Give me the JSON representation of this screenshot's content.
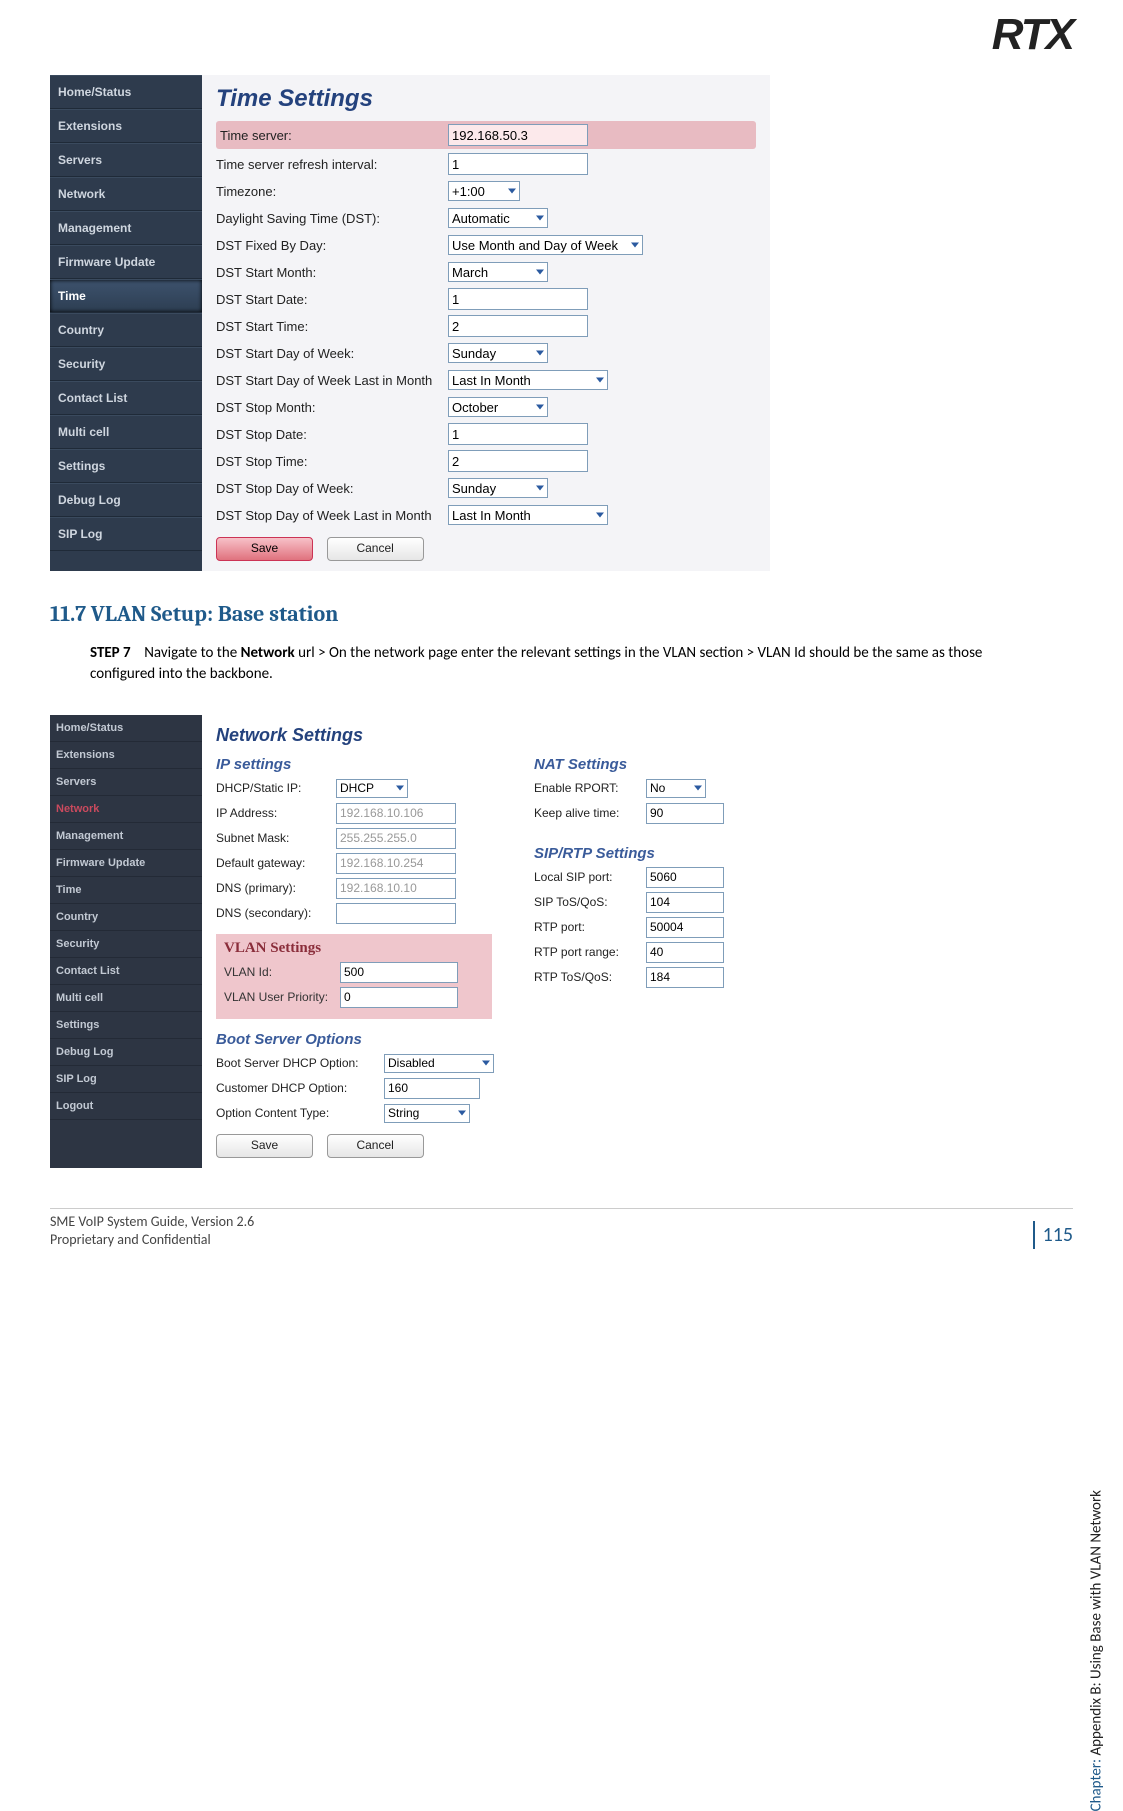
{
  "logo": "RTX",
  "sidebar1": {
    "items": [
      "Home/Status",
      "Extensions",
      "Servers",
      "Network",
      "Management",
      "Firmware Update",
      "Time",
      "Country",
      "Security",
      "Contact List",
      "Multi cell",
      "Settings",
      "Debug Log",
      "SIP Log"
    ],
    "active_index": 6
  },
  "time_settings": {
    "title": "Time Settings",
    "rows": [
      {
        "label": "Time server:",
        "value": "192.168.50.3",
        "type": "input",
        "hl": true
      },
      {
        "label": "Time server refresh interval:",
        "value": "1",
        "type": "input"
      },
      {
        "label": "Timezone:",
        "value": "+1:00",
        "type": "select",
        "cls": "sel-sm"
      },
      {
        "label": "Daylight Saving Time (DST):",
        "value": "Automatic",
        "type": "select",
        "cls": "sel-md"
      },
      {
        "label": "DST Fixed By Day:",
        "value": "Use Month and Day of Week",
        "type": "select",
        "cls": "sel-lg"
      },
      {
        "label": "DST Start Month:",
        "value": "March",
        "type": "select",
        "cls": "sel-md"
      },
      {
        "label": "DST Start Date:",
        "value": "1",
        "type": "input"
      },
      {
        "label": "DST Start Time:",
        "value": "2",
        "type": "input"
      },
      {
        "label": "DST Start Day of Week:",
        "value": "Sunday",
        "type": "select",
        "cls": "sel-md"
      },
      {
        "label": "DST Start Day of Week Last in Month",
        "value": "Last In Month",
        "type": "select",
        "cls": "sel-xl"
      },
      {
        "label": "DST Stop Month:",
        "value": "October",
        "type": "select",
        "cls": "sel-md"
      },
      {
        "label": "DST Stop Date:",
        "value": "1",
        "type": "input"
      },
      {
        "label": "DST Stop Time:",
        "value": "2",
        "type": "input"
      },
      {
        "label": "DST Stop Day of Week:",
        "value": "Sunday",
        "type": "select",
        "cls": "sel-md"
      },
      {
        "label": "DST Stop Day of Week Last in Month",
        "value": "Last In Month",
        "type": "select",
        "cls": "sel-xl"
      }
    ],
    "save": "Save",
    "cancel": "Cancel"
  },
  "section": {
    "heading": "11.7 VLAN Setup: Base station",
    "step": "STEP 7",
    "body1": "Navigate to the ",
    "bold": "Network",
    "body2": " url > On the network page enter the relevant settings in the VLAN section > VLAN Id should be the same as those configured into the backbone."
  },
  "sidebar2": {
    "items": [
      "Home/Status",
      "Extensions",
      "Servers",
      "Network",
      "Management",
      "Firmware Update",
      "Time",
      "Country",
      "Security",
      "Contact List",
      "Multi cell",
      "Settings",
      "Debug Log",
      "SIP Log",
      "Logout"
    ],
    "highlight_index": 3
  },
  "network": {
    "title": "Network Settings",
    "ip": {
      "heading": "IP settings",
      "dhcp_lbl": "DHCP/Static IP:",
      "dhcp": "DHCP",
      "ipaddr_lbl": "IP Address:",
      "ipaddr": "192.168.10.106",
      "mask_lbl": "Subnet Mask:",
      "mask": "255.255.255.0",
      "gw_lbl": "Default gateway:",
      "gw": "192.168.10.254",
      "dns1_lbl": "DNS (primary):",
      "dns1": "192.168.10.10",
      "dns2_lbl": "DNS (secondary):",
      "dns2": ""
    },
    "vlan": {
      "heading": "VLAN Settings",
      "id_lbl": "VLAN Id:",
      "id": "500",
      "prio_lbl": "VLAN User Priority:",
      "prio": "0"
    },
    "boot": {
      "heading": "Boot Server Options",
      "bsd_lbl": "Boot Server DHCP Option:",
      "bsd": "Disabled",
      "cd_lbl": "Customer DHCP Option:",
      "cd": "160",
      "oct_lbl": "Option Content Type:",
      "oct": "String"
    },
    "nat": {
      "heading": "NAT Settings",
      "rport_lbl": "Enable RPORT:",
      "rport": "No",
      "keep_lbl": "Keep alive time:",
      "keep": "90"
    },
    "sip": {
      "heading": "SIP/RTP Settings",
      "lsp_lbl": "Local SIP port:",
      "lsp": "5060",
      "stq_lbl": "SIP ToS/QoS:",
      "stq": "104",
      "rtp_lbl": "RTP port:",
      "rtp": "50004",
      "rng_lbl": "RTP port range:",
      "rng": "40",
      "rtq_lbl": "RTP ToS/QoS:",
      "rtq": "184"
    },
    "save": "Save",
    "cancel": "Cancel"
  },
  "vtext": {
    "cat": "Chapter:",
    "rest": " Appendix B: Using Base with VLAN Network"
  },
  "footer": {
    "l1": "SME VoIP System Guide, Version 2.6",
    "l2": "Proprietary and Confidential",
    "page": "115"
  }
}
